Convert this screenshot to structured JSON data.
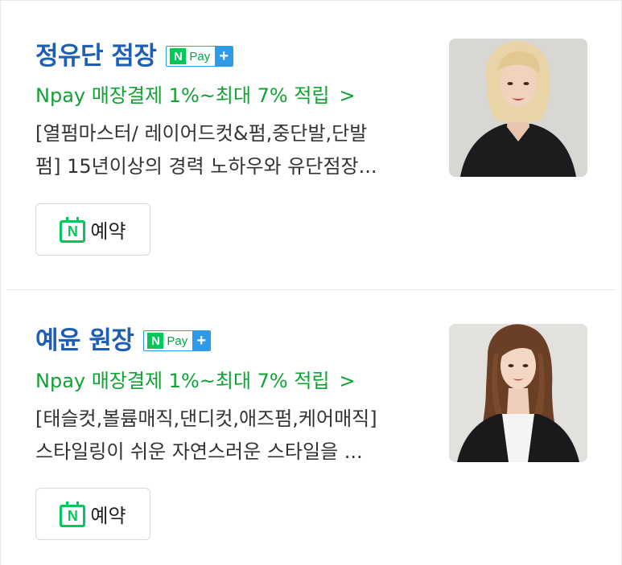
{
  "listings": [
    {
      "name": "정유단 점장",
      "badge": {
        "n": "N",
        "pay": "Pay",
        "plus": "+"
      },
      "promo": "Npay 매장결제 1%~최대 7% 적립",
      "promo_chevron": ">",
      "desc_line1": "[열펌마스터/ 레이어드컷&펌,중단발,단발",
      "desc_line2": "펌] 15년이상의 경력 노하우와 유단점장...",
      "reserve_icon_letter": "N",
      "reserve_label": "예약"
    },
    {
      "name": "예윤 원장",
      "badge": {
        "n": "N",
        "pay": "Pay",
        "plus": "+"
      },
      "promo": "Npay 매장결제 1%~최대 7% 적립",
      "promo_chevron": ">",
      "desc_line1": "[태슬컷,볼륨매직,댄디컷,애즈펌,케어매직]",
      "desc_line2": "스타일링이 쉬운 자연스러운 스타일을 ...",
      "reserve_icon_letter": "N",
      "reserve_label": "예약"
    }
  ],
  "colors": {
    "name": "#1d5fb4",
    "promo": "#0fa332",
    "naver_green": "#03c75a",
    "badge_blue": "#2f9ae8"
  }
}
